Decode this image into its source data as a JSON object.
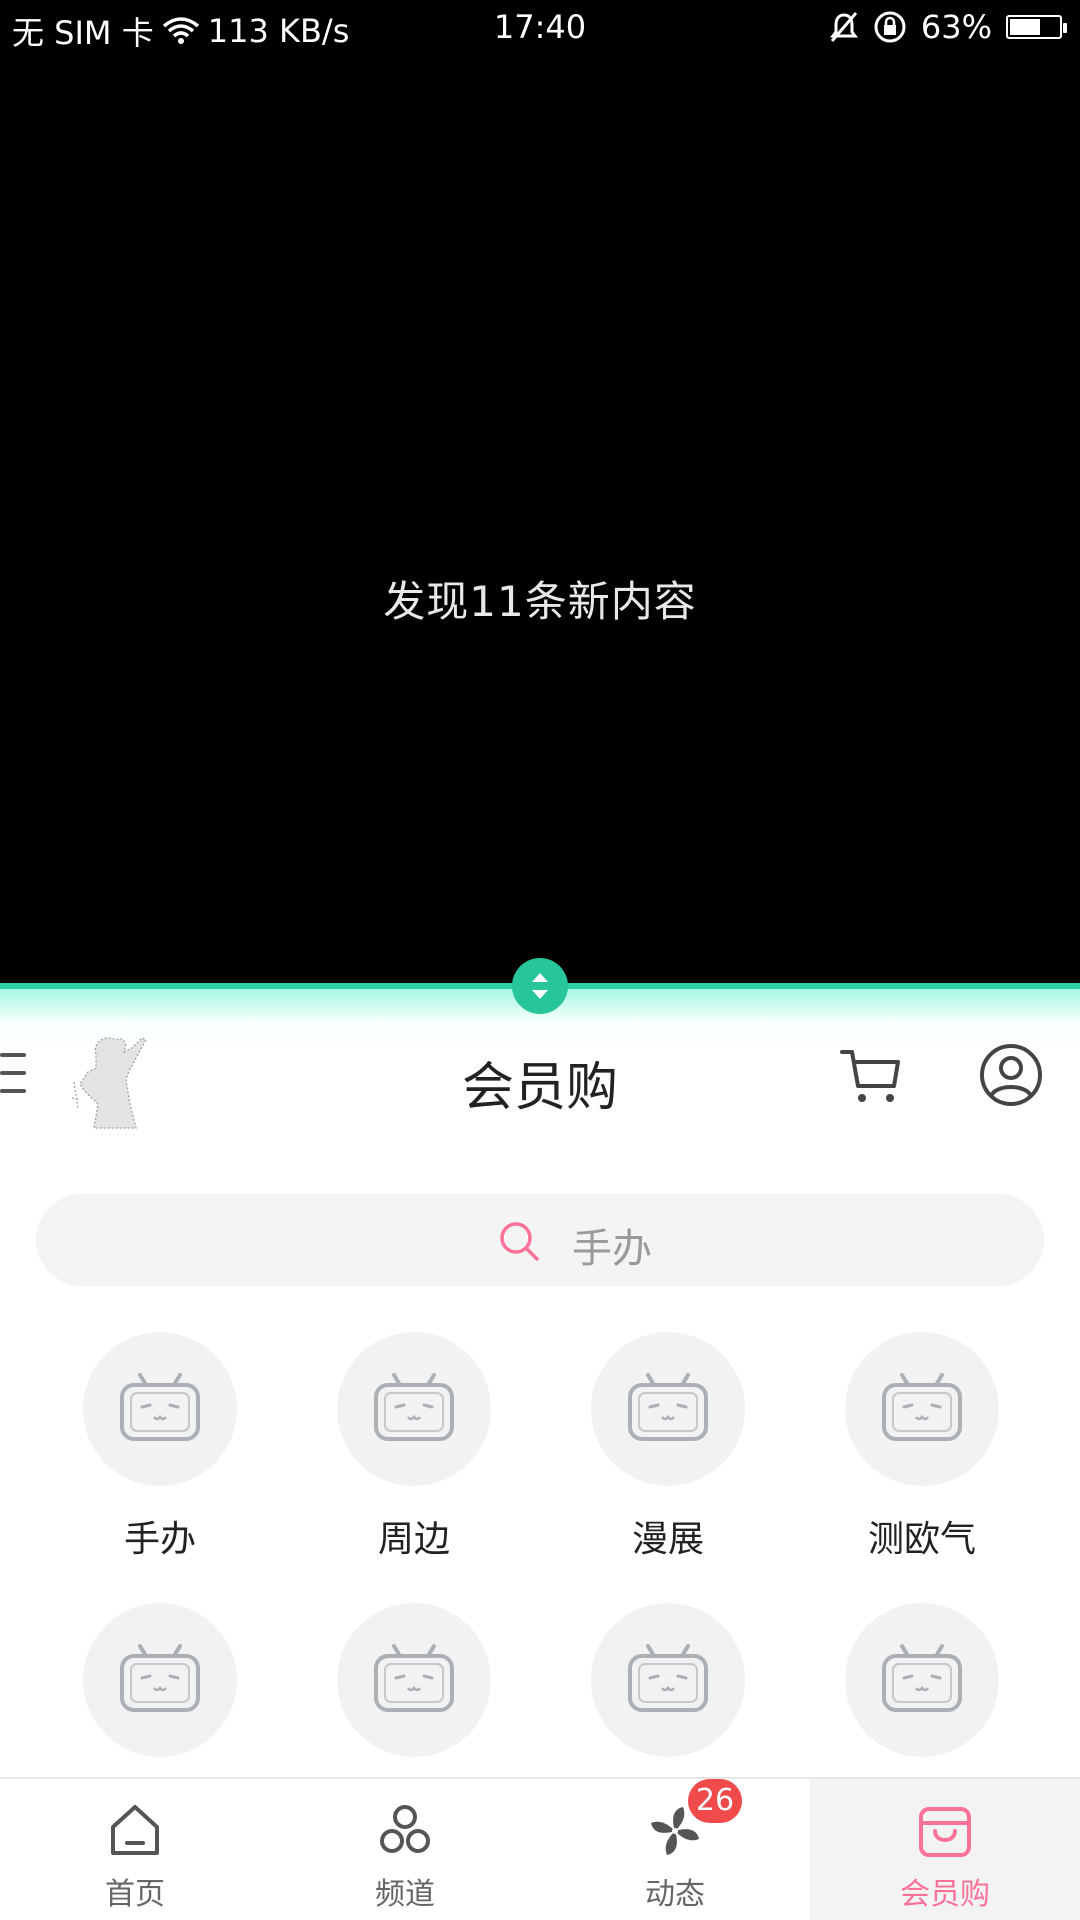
{
  "status_bar": {
    "carrier": "无 SIM 卡",
    "net_speed": "113 KB/s",
    "time": "17:40",
    "battery": "63%",
    "battery_level": 0.63
  },
  "player": {
    "message": "发现11条新内容"
  },
  "header": {
    "title": "会员购"
  },
  "search": {
    "placeholder": "手办"
  },
  "categories": [
    {
      "label": "手办"
    },
    {
      "label": "周边"
    },
    {
      "label": "漫展"
    },
    {
      "label": "测欧气"
    }
  ],
  "bottom_nav": {
    "items": [
      {
        "label": "首页",
        "icon": "home-icon"
      },
      {
        "label": "频道",
        "icon": "channels-icon"
      },
      {
        "label": "动态",
        "icon": "pinwheel-icon",
        "badge": "26"
      },
      {
        "label": "会员购",
        "icon": "shopping-bag-icon",
        "active": true
      }
    ]
  },
  "colors": {
    "accent_pink": "#fb7299",
    "divider_green": "#2fd4a6",
    "badge_red": "#f04a4a"
  }
}
